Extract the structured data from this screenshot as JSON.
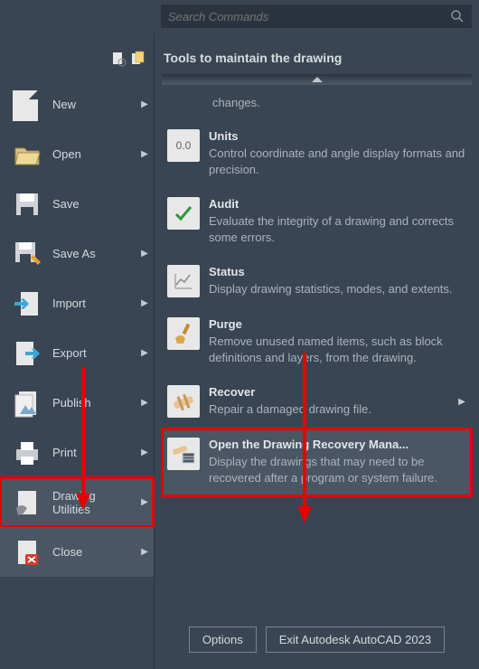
{
  "search": {
    "placeholder": "Search Commands"
  },
  "left_menu": [
    {
      "label": "New",
      "has_sub": true
    },
    {
      "label": "Open",
      "has_sub": true
    },
    {
      "label": "Save",
      "has_sub": false
    },
    {
      "label": "Save As",
      "has_sub": true
    },
    {
      "label": "Import",
      "has_sub": true
    },
    {
      "label": "Export",
      "has_sub": true
    },
    {
      "label": "Publish",
      "has_sub": true
    },
    {
      "label": "Print",
      "has_sub": true
    },
    {
      "label": "Drawing Utilities",
      "has_sub": true,
      "selected": true
    },
    {
      "label": "Close",
      "has_sub": true
    }
  ],
  "pane": {
    "title": "Tools to maintain the drawing",
    "truncated_top": "changes.",
    "tools": [
      {
        "title": "Units",
        "desc": "Control coordinate and angle display formats and precision.",
        "icon": "0.0"
      },
      {
        "title": "Audit",
        "desc": "Evaluate the integrity of a drawing and corrects some errors.",
        "icon": "check"
      },
      {
        "title": "Status",
        "desc": "Display drawing statistics, modes, and extents.",
        "icon": "chart"
      },
      {
        "title": "Purge",
        "desc": "Remove unused named items, such as block definitions and layers, from the drawing.",
        "icon": "broom"
      },
      {
        "title": "Recover",
        "desc": "Repair a damaged drawing file.",
        "icon": "bandage",
        "has_sub": true
      },
      {
        "title": "Open the Drawing Recovery Mana...",
        "desc": "Display the drawings that may need to be recovered after a program or system failure.",
        "icon": "bandage-list",
        "selected": true
      }
    ]
  },
  "footer": {
    "options": "Options",
    "exit": "Exit Autodesk AutoCAD 2023"
  }
}
